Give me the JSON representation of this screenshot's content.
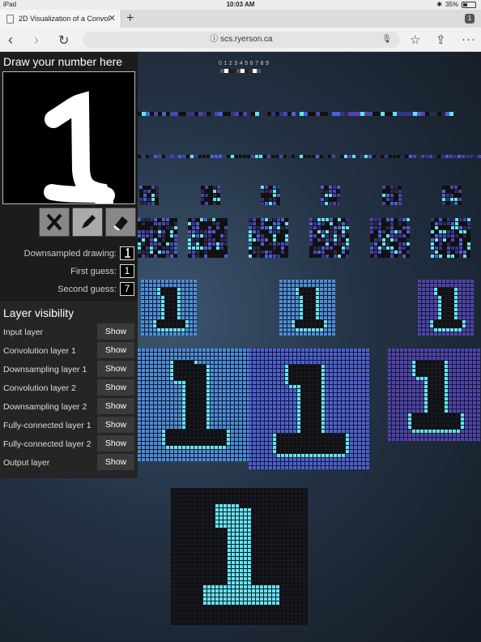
{
  "status_bar": {
    "device": "iPad",
    "time": "10:03 AM",
    "battery": "35%",
    "battery_level": 0.35
  },
  "tab": {
    "title": "2D Visualization of a Convol",
    "close_icon": "close-icon",
    "count": "1"
  },
  "url_bar": {
    "url": "scs.ryerson.ca"
  },
  "draw": {
    "title": "Draw your number here",
    "tools": [
      "clear-x-icon",
      "pencil-icon",
      "eraser-icon"
    ]
  },
  "info": {
    "downsampled_label": "Downsampled drawing:",
    "first_guess_label": "First guess:",
    "first_guess_value": "1",
    "second_guess_label": "Second guess:",
    "second_guess_value": "7"
  },
  "layer_visibility": {
    "title": "Layer visibility",
    "rows": [
      {
        "label": "Input layer",
        "button": "Show"
      },
      {
        "label": "Convolution layer 1",
        "button": "Show"
      },
      {
        "label": "Downsampling layer 1",
        "button": "Show"
      },
      {
        "label": "Convolution layer 2",
        "button": "Show"
      },
      {
        "label": "Downsampling layer 2",
        "button": "Show"
      },
      {
        "label": "Fully-connected layer 1",
        "button": "Show"
      },
      {
        "label": "Fully-connected layer 2",
        "button": "Show"
      },
      {
        "label": "Output layer",
        "button": "Show"
      }
    ]
  },
  "output_labels": "0 1 2 3 4 5 6 7 8 9",
  "colors": {
    "page_bg": "#2b3c4e",
    "cyan": "#61e6f0",
    "blue_bright": "#4a8fd9",
    "blue_mid": "#4a62d6",
    "purple": "#4f44b0",
    "dark_cell": "#111111"
  }
}
